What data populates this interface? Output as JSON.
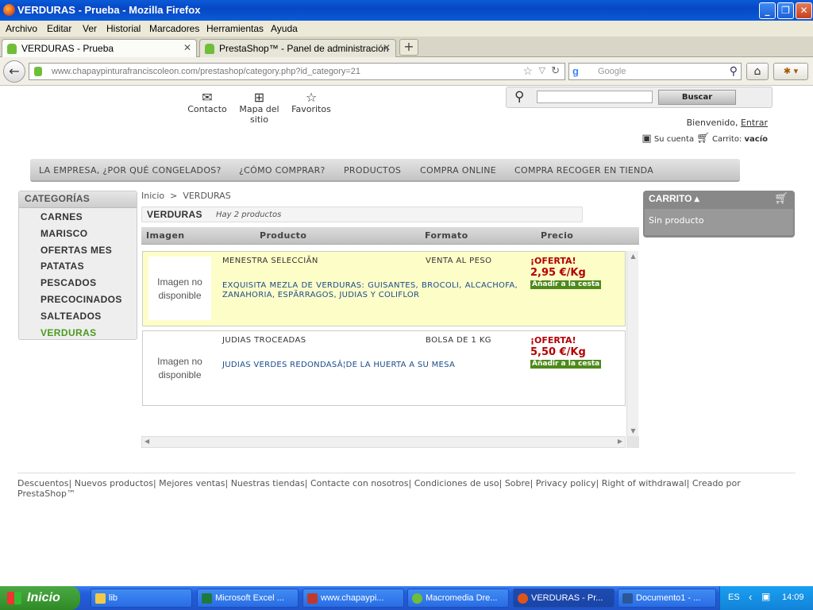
{
  "window": {
    "title": "VERDURAS - Prueba - Mozilla Firefox",
    "minimize": "_",
    "restore": "❐",
    "close": "✕"
  },
  "menu": [
    "Archivo",
    "Editar",
    "Ver",
    "Historial",
    "Marcadores",
    "Herramientas",
    "Ayuda"
  ],
  "tabs": [
    {
      "label": "VERDURAS - Prueba",
      "close": "✕"
    },
    {
      "label": "PrestaShop™ - Panel de administración",
      "close": "✕"
    }
  ],
  "newtab": "+",
  "nav": {
    "url": "www.chapaypinturafranciscoleon.com/prestashop/category.php?id_category=21",
    "search_placeholder": "Google",
    "search_engine_glyph": "g"
  },
  "page": {
    "toplinks": [
      {
        "label": "Contacto",
        "icon": "mail-icon"
      },
      {
        "label": "Mapa del sitio",
        "icon": "sitemap-icon"
      },
      {
        "label": "Favoritos",
        "icon": "star-icon"
      }
    ],
    "search": {
      "button": "Buscar",
      "value": ""
    },
    "welcome": {
      "text": "Bienvenido,",
      "link": "Entrar"
    },
    "account": {
      "label": "Su cuenta",
      "cart_label": "Carrito:",
      "cart_value": "vacío"
    },
    "topmenu": [
      "LA EMPRESA, ¿POR QUÉ CONGELADOS?",
      "¿CÓMO COMPRAR?",
      "PRODUCTOS",
      "COMPRA ONLINE",
      "COMPRA RECOGER EN TIENDA"
    ],
    "categories": {
      "title": "CATEGORÍAS",
      "items": [
        "CARNES",
        "MARISCO",
        "OFERTAS MES",
        "PATATAS",
        "PESCADOS",
        "PRECOCINADOS",
        "SALTEADOS",
        "VERDURAS"
      ],
      "active": "VERDURAS"
    },
    "breadcrumb": {
      "home": "Inicio",
      "sep": ">",
      "current": "VERDURAS"
    },
    "category_title": "VERDURAS",
    "product_count": "Hay 2 productos",
    "table_headers": [
      "Imagen",
      "Producto",
      "Formato",
      "Precio"
    ],
    "products": [
      {
        "image_text": "Imagen no disponible",
        "name": "MENESTRA SELECCIĂN",
        "format": "VENTA AL PESO",
        "description": "EXQUISITA MEZLA DE VERDURAS: GUISANTES, BROCOLI, ALCACHOFA, ZANAHORIA, ESPĂRRAGOS, JUDIAS Y COLIFLOR",
        "offer": "¡OFERTA!",
        "price": "2,95 €/Kg",
        "add": "Añadir a la cesta"
      },
      {
        "image_text": "Imagen no disponible",
        "name": "JUDIAS TROCEADAS",
        "format": "BOLSA DE 1 KG",
        "description": "JUDIAS VERDES REDONDASÂ¦DE LA HUERTA A SU MESA",
        "offer": "¡OFERTA!",
        "price": "5,50 €/Kg",
        "add": "Añadir a la cesta"
      }
    ],
    "cart": {
      "title": "CARRITO",
      "empty": "Sin producto"
    },
    "footer": [
      "Descuentos",
      "Nuevos productos",
      "Mejores ventas",
      "Nuestras tiendas",
      "Contacte con nosotros",
      "Condiciones de uso",
      "Sobre",
      "Privacy policy",
      "Right of withdrawal",
      "Creado por PrestaShop™"
    ]
  },
  "taskbar": {
    "start": "Inicio",
    "tasks": [
      {
        "label": "lib",
        "color": "#f3c948"
      },
      {
        "label": "Microsoft Excel ...",
        "color": "#1e7a3c"
      },
      {
        "label": "www.chapaypi...",
        "color": "#c0392b"
      },
      {
        "label": "Macromedia Dre...",
        "color": "#6fbe3a"
      },
      {
        "label": "VERDURAS - Pr...",
        "color": "#e0541a"
      },
      {
        "label": "Documento1 - ...",
        "color": "#2b5797"
      }
    ],
    "lang": "ES",
    "clock": "14:09"
  },
  "colors": {
    "accent_green": "#4a9a1e",
    "offer_red": "#b30000",
    "add_button": "#4e8a1b",
    "desc_blue": "#1a4b8c",
    "product_highlight": "#fdfdc8"
  }
}
